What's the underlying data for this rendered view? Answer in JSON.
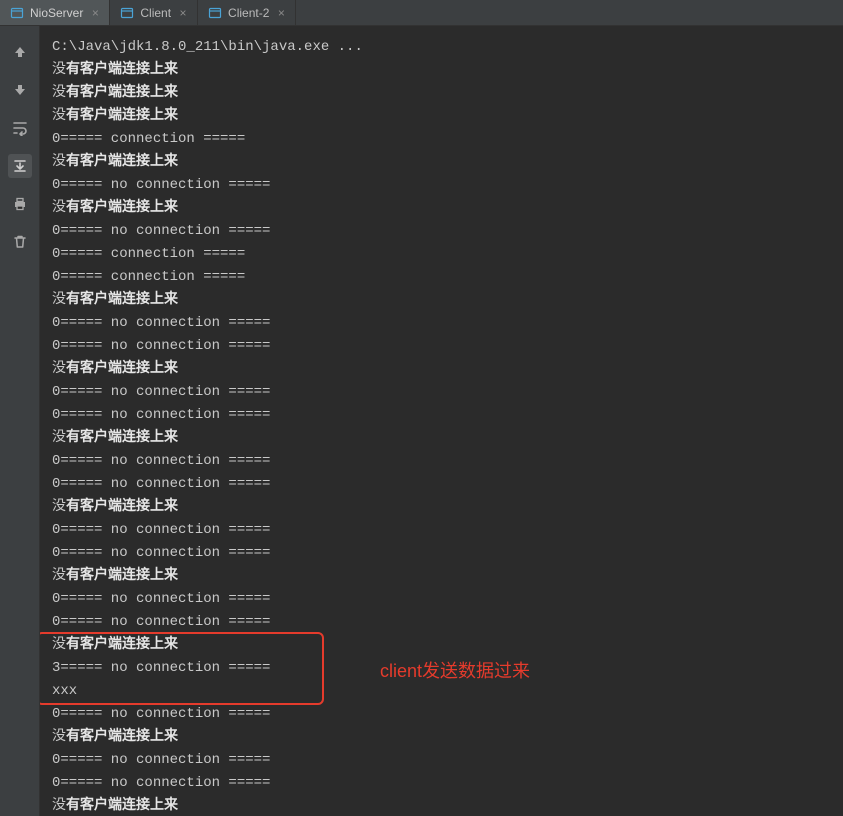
{
  "tabs": [
    {
      "label": "NioServer",
      "active": true
    },
    {
      "label": "Client",
      "active": false
    },
    {
      "label": "Client-2",
      "active": false
    }
  ],
  "gutter": {
    "up": "arrow-up-icon",
    "down": "arrow-down-icon",
    "wrap": "soft-wrap-icon",
    "scroll": "scroll-to-end-icon",
    "print": "print-icon",
    "trash": "trash-icon"
  },
  "annotation": "client发送数据过来",
  "highlighted_index_start": 26,
  "highlighted_index_end": 28,
  "console_lines": [
    {
      "text": "C:\\Java\\jdk1.8.0_211\\bin\\java.exe ..."
    },
    {
      "text": "没",
      "bold_rest": "有客户端连接上来"
    },
    {
      "text": "没",
      "bold_rest": "有客户端连接上来"
    },
    {
      "text": "没",
      "bold_rest": "有客户端连接上来"
    },
    {
      "text": "0===== connection ====="
    },
    {
      "text": "没",
      "bold_rest": "有客户端连接上来"
    },
    {
      "text": "0===== no connection ====="
    },
    {
      "text": "没",
      "bold_rest": "有客户端连接上来"
    },
    {
      "text": "0===== no connection ====="
    },
    {
      "text": "0===== connection ====="
    },
    {
      "text": "0===== connection ====="
    },
    {
      "text": "没",
      "bold_rest": "有客户端连接上来"
    },
    {
      "text": "0===== no connection ====="
    },
    {
      "text": "0===== no connection ====="
    },
    {
      "text": "没",
      "bold_rest": "有客户端连接上来"
    },
    {
      "text": "0===== no connection ====="
    },
    {
      "text": "0===== no connection ====="
    },
    {
      "text": "没",
      "bold_rest": "有客户端连接上来"
    },
    {
      "text": "0===== no connection ====="
    },
    {
      "text": "0===== no connection ====="
    },
    {
      "text": "没",
      "bold_rest": "有客户端连接上来"
    },
    {
      "text": "0===== no connection ====="
    },
    {
      "text": "0===== no connection ====="
    },
    {
      "text": "没",
      "bold_rest": "有客户端连接上来"
    },
    {
      "text": "0===== no connection ====="
    },
    {
      "text": "0===== no connection ====="
    },
    {
      "text": "没",
      "bold_rest": "有客户端连接上来"
    },
    {
      "text": "3===== no connection ====="
    },
    {
      "text": "xxx"
    },
    {
      "text": "0===== no connection ====="
    },
    {
      "text": "没",
      "bold_rest": "有客户端连接上来"
    },
    {
      "text": "0===== no connection ====="
    },
    {
      "text": "0===== no connection ====="
    },
    {
      "text": "没",
      "bold_rest": "有客户端连接上来"
    }
  ]
}
